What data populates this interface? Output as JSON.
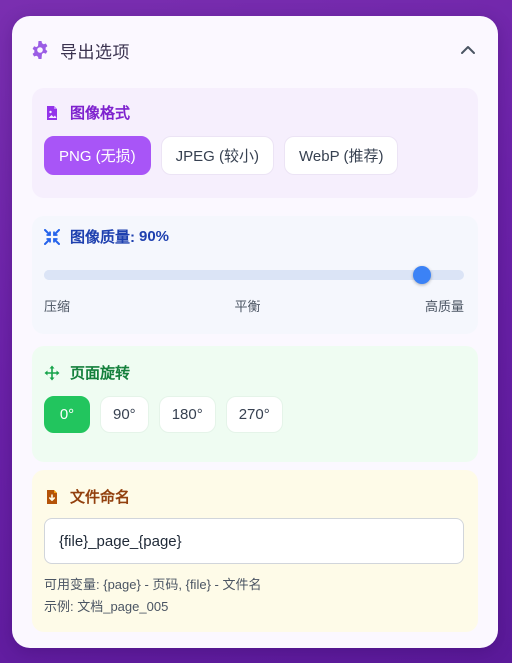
{
  "panel": {
    "title": "导出选项"
  },
  "format": {
    "title": "图像格式",
    "options": [
      "PNG (无损)",
      "JPEG (较小)",
      "WebP (推荐)"
    ],
    "selected": 0,
    "accent": "#a855f7"
  },
  "quality": {
    "title_prefix": "图像质量:",
    "value_label": "90%",
    "value": 90,
    "min_label": "压缩",
    "mid_label": "平衡",
    "max_label": "高质量",
    "accent": "#3b82f6"
  },
  "rotation": {
    "title": "页面旋转",
    "options": [
      "0°",
      "90°",
      "180°",
      "270°"
    ],
    "selected": 0,
    "accent": "#22c55e"
  },
  "naming": {
    "title": "文件命名",
    "input_value": "{file}_page_{page}",
    "hint_vars": "可用变量: {page} - 页码, {file} - 文件名",
    "hint_example": "示例: 文档_page_005"
  }
}
